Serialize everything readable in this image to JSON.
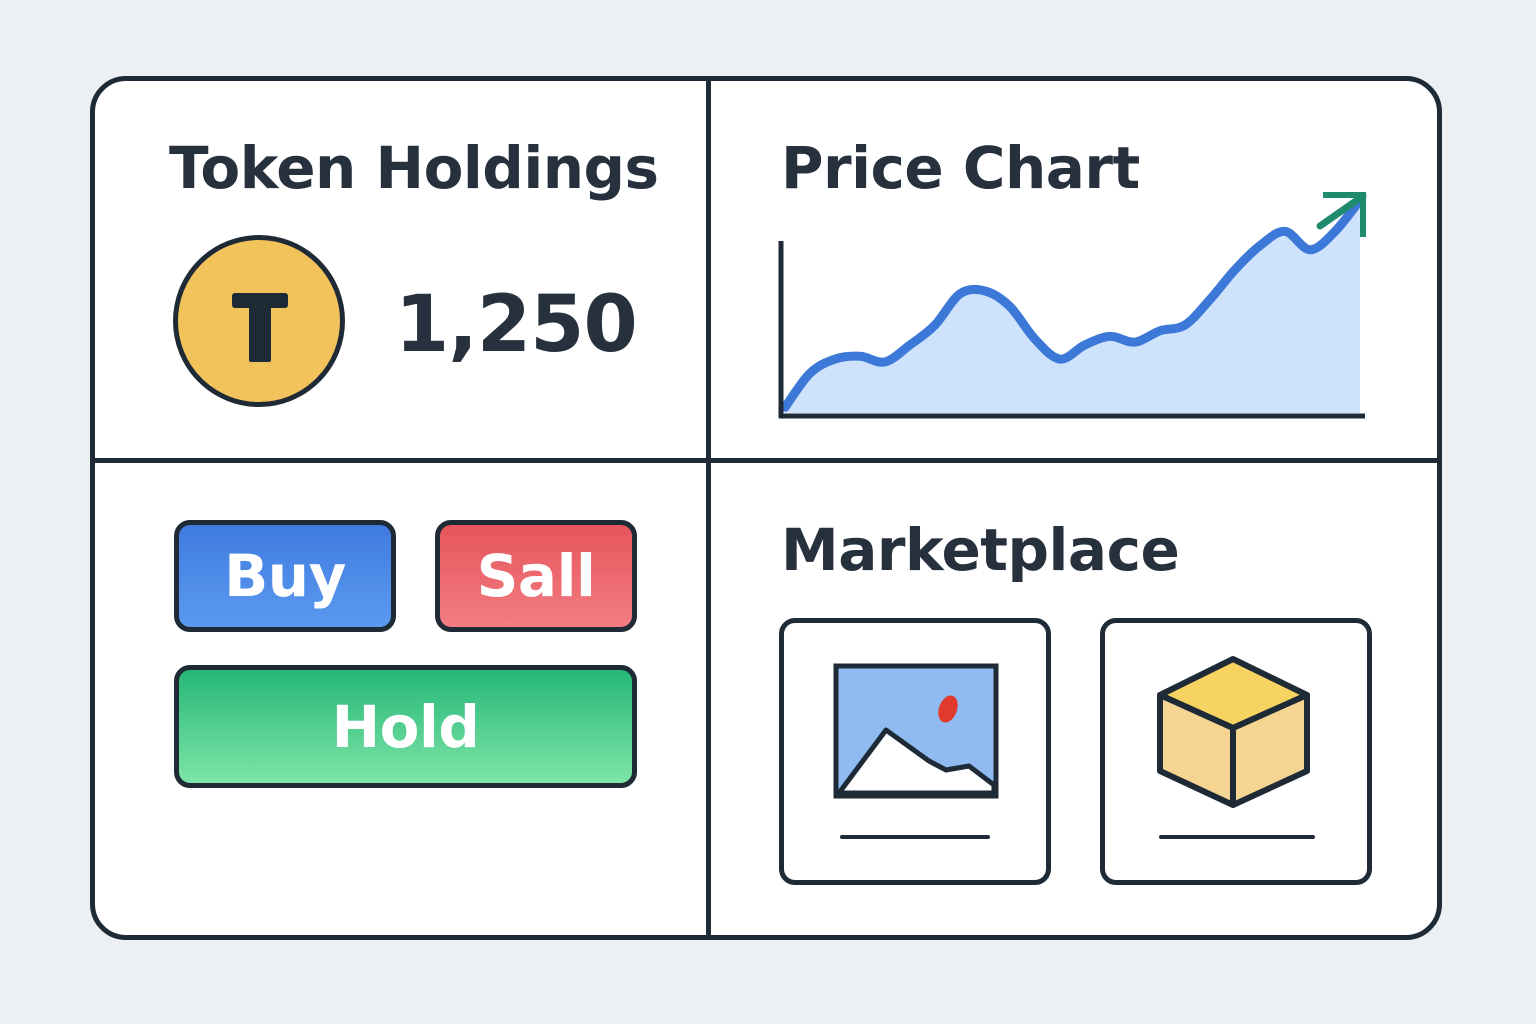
{
  "token_panel": {
    "title": "Token Holdings",
    "coin_letter": "T",
    "amount": "1,250"
  },
  "chart_panel": {
    "title": "Price Chart",
    "chart_data": {
      "type": "area",
      "title": "Price Chart",
      "xlabel": "",
      "ylabel": "",
      "x": [
        0,
        1,
        2,
        3,
        4,
        5,
        6,
        7,
        8,
        9,
        10,
        11,
        12,
        13,
        14,
        15,
        16,
        17,
        18,
        19,
        20,
        21,
        22,
        23
      ],
      "values": [
        4,
        28,
        38,
        40,
        36,
        48,
        62,
        84,
        86,
        75,
        52,
        38,
        48,
        54,
        50,
        58,
        62,
        80,
        101,
        118,
        128,
        115,
        128,
        150
      ],
      "ylim": [
        0,
        160
      ],
      "trend": "up",
      "colors": {
        "line": "#3b78d8",
        "fill": "#cfe2fb",
        "arrow": "#1f8a6e"
      }
    }
  },
  "actions_panel": {
    "buy_label": "Buy",
    "sell_label": "Sall",
    "hold_label": "Hold",
    "colors": {
      "buy": "#3f7bdf",
      "sell": "#e6555b",
      "hold": "#2fbe7b"
    }
  },
  "marketplace_panel": {
    "title": "Marketplace",
    "items": [
      {
        "icon": "image-icon"
      },
      {
        "icon": "cube-icon"
      }
    ]
  }
}
